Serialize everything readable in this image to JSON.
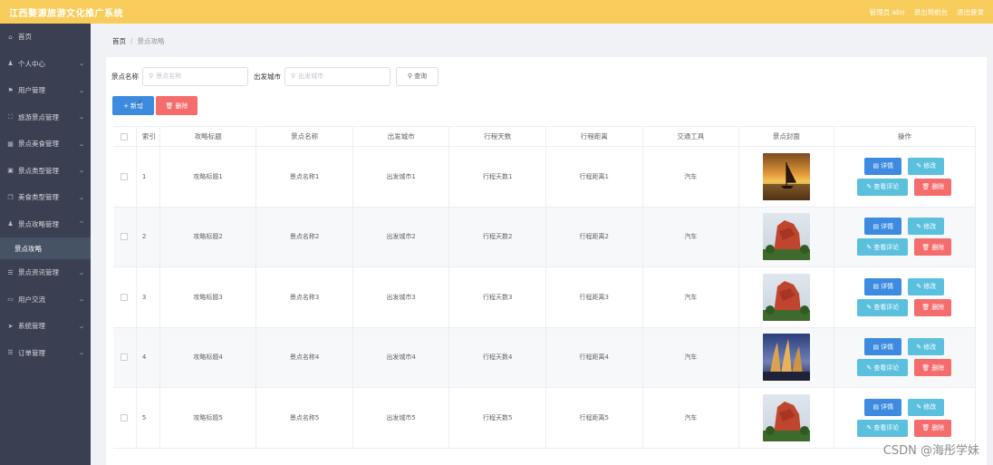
{
  "header": {
    "title": "江西婺源旅游文化推广系统",
    "links": [
      "管理员 abo",
      "退出到前台",
      "退出登录"
    ]
  },
  "sidebar": {
    "items": [
      {
        "label": "首页",
        "icon": "home-icon",
        "glyph": "⌂",
        "arrow": false
      },
      {
        "label": "个人中心",
        "icon": "user-icon",
        "glyph": "♟",
        "arrow": true
      },
      {
        "label": "用户管理",
        "icon": "flag-icon",
        "glyph": "⚑",
        "arrow": true
      },
      {
        "label": "旅游景点管理",
        "icon": "scan-icon",
        "glyph": "⛶",
        "arrow": true
      },
      {
        "label": "景点美食管理",
        "icon": "grid-icon",
        "glyph": "▦",
        "arrow": true
      },
      {
        "label": "景点类型管理",
        "icon": "picture-icon",
        "glyph": "▣",
        "arrow": true
      },
      {
        "label": "美食类型管理",
        "icon": "copy-icon",
        "glyph": "❐",
        "arrow": true
      },
      {
        "label": "景点攻略管理",
        "icon": "user-icon",
        "glyph": "♟",
        "arrow": true,
        "expanded": true
      }
    ],
    "sub_item": "景点攻略",
    "items_after": [
      {
        "label": "景点资讯管理",
        "icon": "list-icon",
        "glyph": "☰",
        "arrow": true
      },
      {
        "label": "用户交流",
        "icon": "chat-icon",
        "glyph": "▭",
        "arrow": true
      },
      {
        "label": "系统管理",
        "icon": "send-icon",
        "glyph": "➤",
        "arrow": true
      },
      {
        "label": "订单管理",
        "icon": "menu-icon",
        "glyph": "☰",
        "arrow": true
      }
    ]
  },
  "breadcrumb": {
    "home": "首页",
    "separator": "/",
    "current": "景点攻略"
  },
  "search": {
    "name_label": "景点名称",
    "name_placeholder": "景点名称",
    "city_label": "出发城市",
    "city_placeholder": "出发城市",
    "query_label": "查询"
  },
  "actions": {
    "add_label": "新增",
    "delete_label": "删除"
  },
  "table": {
    "headers": [
      "索引",
      "攻略标题",
      "景点名称",
      "出发城市",
      "行程天数",
      "行程距离",
      "交通工具",
      "景点封面",
      "操作"
    ],
    "rows": [
      {
        "index": "1",
        "title": "攻略标题1",
        "name": "景点名称1",
        "city": "出发城市1",
        "days": "行程天数1",
        "distance": "行程距离1",
        "transport": "汽车",
        "cover": "sunset"
      },
      {
        "index": "2",
        "title": "攻略标题2",
        "name": "景点名称2",
        "city": "出发城市2",
        "days": "行程天数2",
        "distance": "行程距离2",
        "transport": "汽车",
        "cover": "rock"
      },
      {
        "index": "3",
        "title": "攻略标题3",
        "name": "景点名称3",
        "city": "出发城市3",
        "days": "行程天数3",
        "distance": "行程距离3",
        "transport": "汽车",
        "cover": "rock"
      },
      {
        "index": "4",
        "title": "攻略标题4",
        "name": "景点名称4",
        "city": "出发城市4",
        "days": "行程天数4",
        "distance": "行程距离4",
        "transport": "汽车",
        "cover": "towers"
      },
      {
        "index": "5",
        "title": "攻略标题5",
        "name": "景点名称5",
        "city": "出发城市5",
        "days": "行程天数5",
        "distance": "行程距离5",
        "transport": "汽车",
        "cover": "rock"
      }
    ],
    "row_buttons": {
      "detail": "详情",
      "edit": "修改",
      "comment": "查看评论",
      "delete": "删除"
    }
  },
  "watermark": "CSDN @海彤学妹",
  "colors": {
    "header": "#f7cc5a",
    "sidebar": "#3a3f51",
    "primary": "#3c8be0",
    "info": "#5bc0de",
    "danger": "#f56c6c"
  }
}
